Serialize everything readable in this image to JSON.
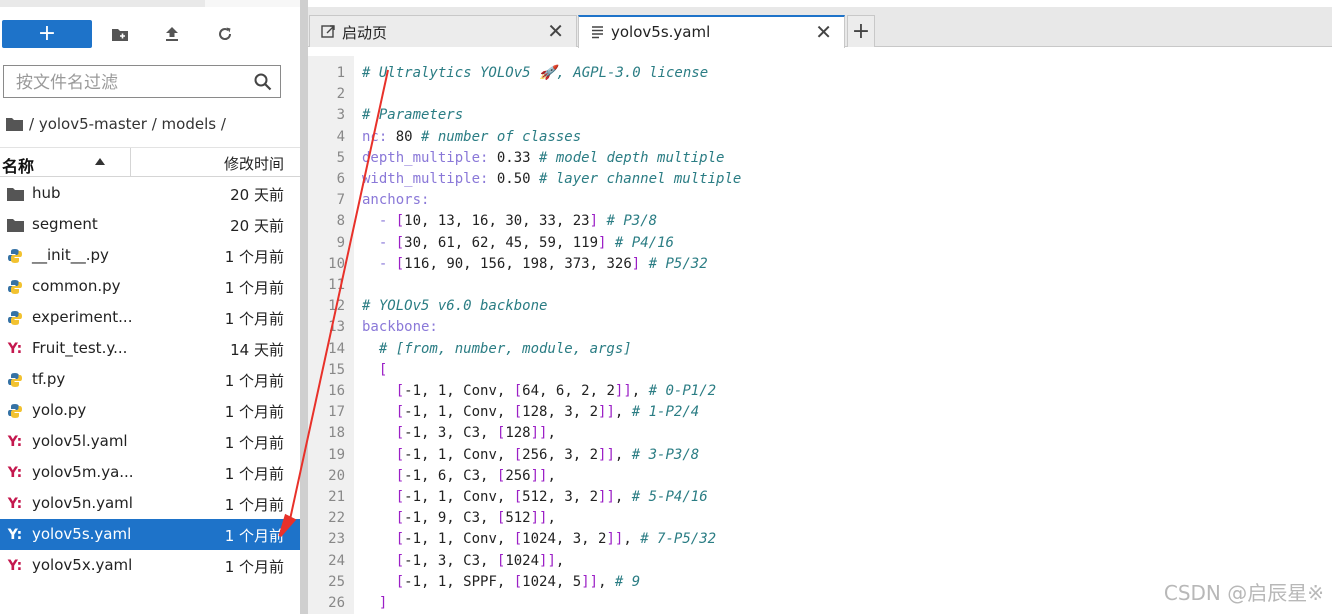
{
  "toolbar": {
    "new_label": "+",
    "new_folder_icon": "folder-plus-icon",
    "upload_icon": "upload-icon",
    "refresh_icon": "refresh-icon"
  },
  "filter": {
    "placeholder": "按文件名过滤"
  },
  "breadcrumb": {
    "path": "/ yolov5-master / models /"
  },
  "file_table": {
    "col_name": "名称",
    "col_modified": "修改时间",
    "files": [
      {
        "name": "hub",
        "modified": "20 天前",
        "icon": "folder-icon"
      },
      {
        "name": "segment",
        "modified": "20 天前",
        "icon": "folder-icon"
      },
      {
        "name": "__init__.py",
        "modified": "1 个月前",
        "icon": "python-icon"
      },
      {
        "name": "common.py",
        "modified": "1 个月前",
        "icon": "python-icon"
      },
      {
        "name": "experiment...",
        "modified": "1 个月前",
        "icon": "python-icon"
      },
      {
        "name": "Fruit_test.y...",
        "modified": "14 天前",
        "icon": "yaml-icon"
      },
      {
        "name": "tf.py",
        "modified": "1 个月前",
        "icon": "python-icon"
      },
      {
        "name": "yolo.py",
        "modified": "1 个月前",
        "icon": "python-icon"
      },
      {
        "name": "yolov5l.yaml",
        "modified": "1 个月前",
        "icon": "yaml-icon"
      },
      {
        "name": "yolov5m.ya...",
        "modified": "1 个月前",
        "icon": "yaml-icon"
      },
      {
        "name": "yolov5n.yaml",
        "modified": "1 个月前",
        "icon": "yaml-icon"
      },
      {
        "name": "yolov5s.yaml",
        "modified": "1 个月前",
        "icon": "yaml-icon",
        "selected": true
      },
      {
        "name": "yolov5x.yaml",
        "modified": "1 个月前",
        "icon": "yaml-icon"
      }
    ]
  },
  "tabs": [
    {
      "label": "启动页",
      "icon": "launcher-icon",
      "active": false
    },
    {
      "label": "yolov5s.yaml",
      "icon": "document-icon",
      "active": true
    }
  ],
  "editor": {
    "lines": [
      "# Ultralytics YOLOv5 🚀, AGPL-3.0 license",
      "",
      "# Parameters",
      "nc: 80 # number of classes",
      "depth_multiple: 0.33 # model depth multiple",
      "width_multiple: 0.50 # layer channel multiple",
      "anchors:",
      "  - [10, 13, 16, 30, 33, 23] # P3/8",
      "  - [30, 61, 62, 45, 59, 119] # P4/16",
      "  - [116, 90, 156, 198, 373, 326] # P5/32",
      "",
      "# YOLOv5 v6.0 backbone",
      "backbone:",
      "  # [from, number, module, args]",
      "  [",
      "    [-1, 1, Conv, [64, 6, 2, 2]], # 0-P1/2",
      "    [-1, 1, Conv, [128, 3, 2]], # 1-P2/4",
      "    [-1, 3, C3, [128]],",
      "    [-1, 1, Conv, [256, 3, 2]], # 3-P3/8",
      "    [-1, 6, C3, [256]],",
      "    [-1, 1, Conv, [512, 3, 2]], # 5-P4/16",
      "    [-1, 9, C3, [512]],",
      "    [-1, 1, Conv, [1024, 3, 2]], # 7-P5/32",
      "    [-1, 3, C3, [1024]],",
      "    [-1, 1, SPPF, [1024, 5]], # 9",
      "  ]"
    ]
  },
  "watermark": "CSDN @启辰星※",
  "colors": {
    "accent": "#1e73c9",
    "yaml_icon": "#c4184e",
    "comment": "#2b7d84",
    "key": "#8a78d8",
    "bracket": "#9b1fc6",
    "annotation_arrow": "#e8312a"
  }
}
